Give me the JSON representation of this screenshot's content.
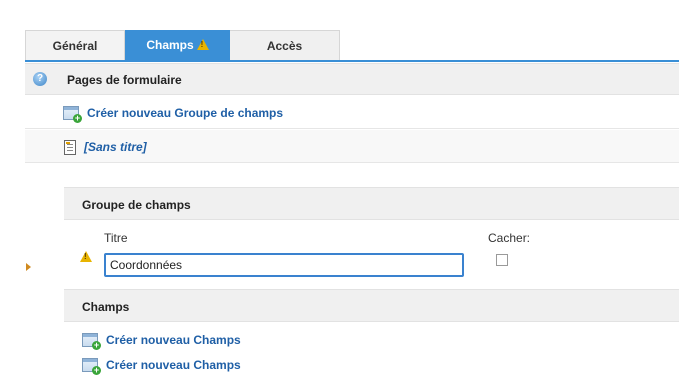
{
  "tabs": [
    {
      "label": "Général"
    },
    {
      "label": "Champs"
    },
    {
      "label": "Accès"
    }
  ],
  "section": {
    "title": "Pages de formulaire"
  },
  "create_group_link": "Créer nouveau Groupe de champs",
  "untitled_page_link": "[Sans titre]",
  "group": {
    "header": "Groupe de champs",
    "title_label": "Titre",
    "hide_label": "Cacher:",
    "title_value": "Coordonnées"
  },
  "fields": {
    "header": "Champs",
    "create_links": [
      "Créer nouveau Champs",
      "Créer nouveau Champs"
    ]
  },
  "colors": {
    "accent": "#3a8fd6",
    "link": "#1f5fa6",
    "warning": "#e8b400"
  },
  "icons": [
    "question-icon",
    "new-group-icon",
    "page-icon",
    "warning-icon",
    "row-marker-icon",
    "new-field-icon"
  ]
}
